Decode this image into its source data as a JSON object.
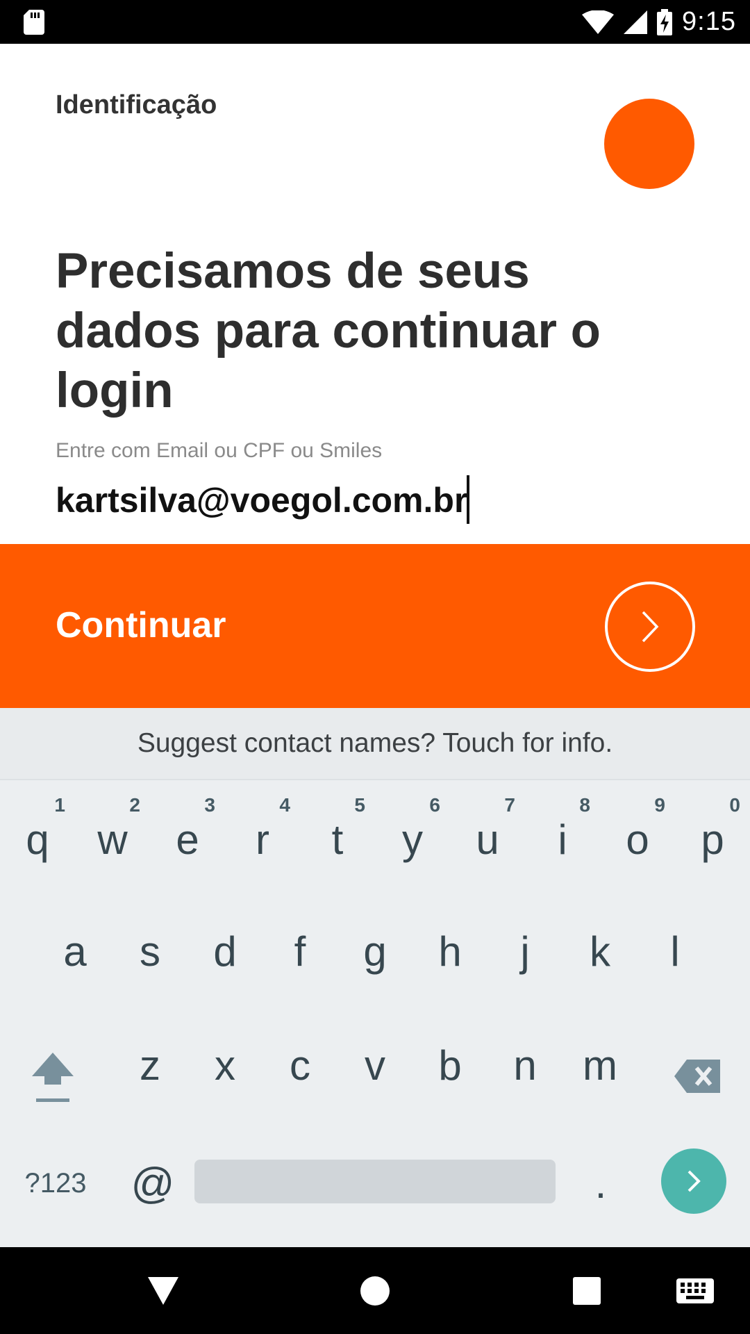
{
  "status_bar": {
    "time": "9:15",
    "icons": [
      "sd-card-icon",
      "wifi-icon",
      "cell-signal-icon",
      "battery-charging-icon"
    ]
  },
  "screen": {
    "title": "Identificação",
    "headline": "Precisamos de seus dados para continuar o login",
    "input_label": "Entre com Email ou CPF ou Smiles",
    "input_value": "kartsilva@voegol.com.br",
    "continue_label": "Continuar",
    "accent_color": "#ff5a00"
  },
  "keyboard": {
    "suggestion": "Suggest contact names? Touch for info.",
    "row1": [
      {
        "key": "q",
        "hint": "1"
      },
      {
        "key": "w",
        "hint": "2"
      },
      {
        "key": "e",
        "hint": "3"
      },
      {
        "key": "r",
        "hint": "4"
      },
      {
        "key": "t",
        "hint": "5"
      },
      {
        "key": "y",
        "hint": "6"
      },
      {
        "key": "u",
        "hint": "7"
      },
      {
        "key": "i",
        "hint": "8"
      },
      {
        "key": "o",
        "hint": "9"
      },
      {
        "key": "p",
        "hint": "0"
      }
    ],
    "row2": [
      "a",
      "s",
      "d",
      "f",
      "g",
      "h",
      "j",
      "k",
      "l"
    ],
    "row3": [
      "z",
      "x",
      "c",
      "v",
      "b",
      "n",
      "m"
    ],
    "symbols_label": "?123",
    "at_label": "@",
    "period_label": ".",
    "enter_color": "#4db6ac"
  },
  "nav_bar": {
    "icons": [
      "back-icon",
      "home-icon",
      "recents-icon",
      "keyboard-switch-icon"
    ]
  }
}
